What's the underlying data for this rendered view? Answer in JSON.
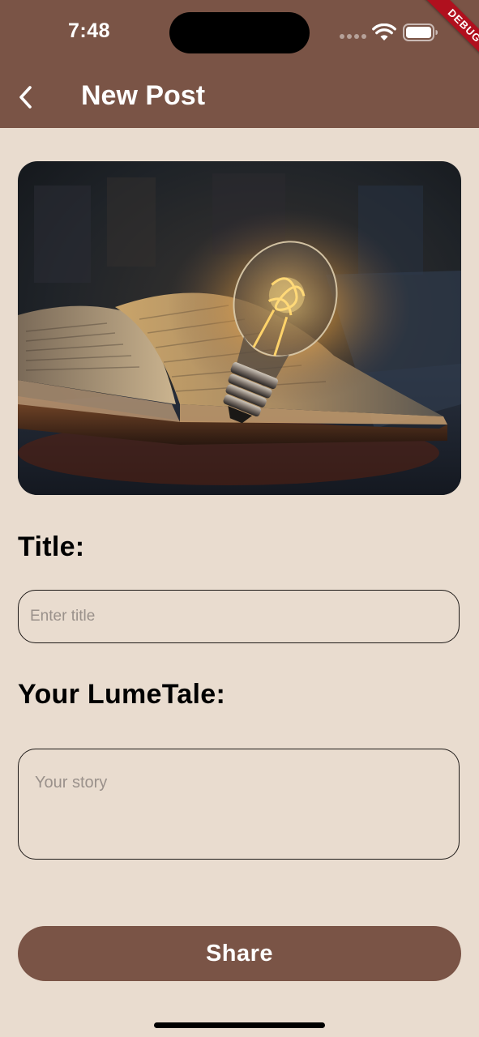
{
  "status_bar": {
    "time": "7:48",
    "debug_label": "DEBUG"
  },
  "header": {
    "title": "New Post",
    "background_color": "#7a5446"
  },
  "form": {
    "title_label": "Title:",
    "title_placeholder": "Enter title",
    "title_value": "",
    "story_label": "Your LumeTale:",
    "story_placeholder": "Your story",
    "story_value": ""
  },
  "actions": {
    "share_label": "Share"
  },
  "colors": {
    "page_background": "#e9dccf",
    "accent": "#7a5446"
  },
  "icons": {
    "back": "chevron-left-icon",
    "wifi": "wifi-icon",
    "battery": "battery-icon",
    "signal": "signal-icon"
  }
}
